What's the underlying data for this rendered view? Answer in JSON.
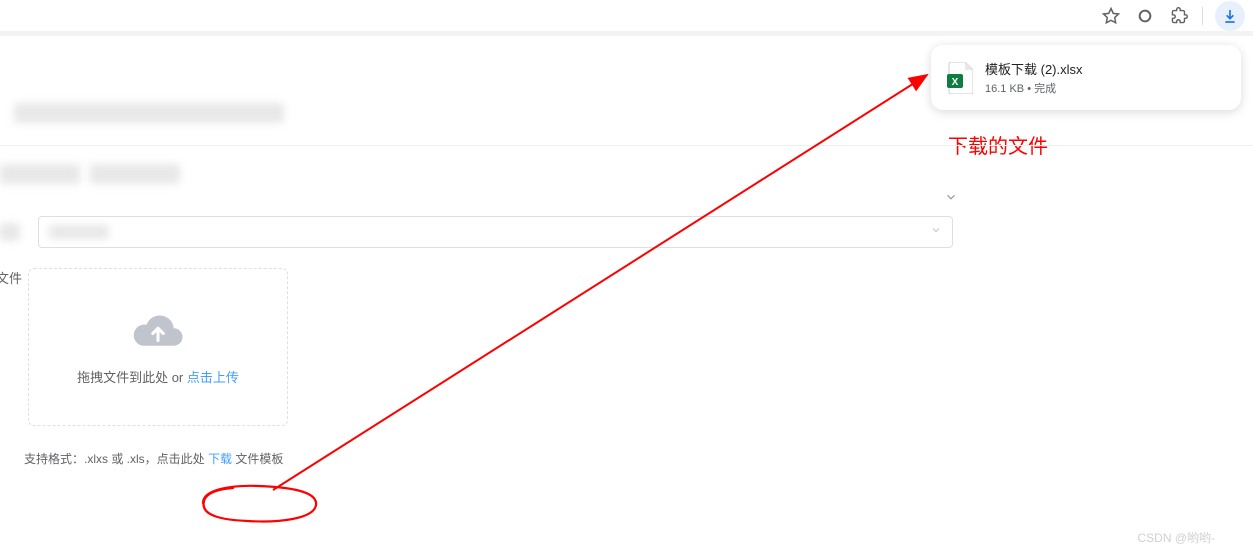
{
  "browser": {
    "icons": {
      "star": "☆",
      "circle": "◯",
      "puzzle": "🧩",
      "download": "↓"
    }
  },
  "download_popup": {
    "filename": "模板下载 (2).xlsx",
    "meta": "16.1 KB • 完成"
  },
  "annotation": {
    "text": "下载的文件",
    "arrow_color": "#ff0000"
  },
  "form": {
    "upload_label": "文件",
    "upload_text_drag": "拖拽文件到此处 or ",
    "upload_text_click": "点击上传",
    "hint_prefix": "支持格式：.xlxs 或 .xls，点击此处 ",
    "hint_link": "下载",
    "hint_suffix": " 文件模板"
  },
  "watermark": "CSDN @哟哟-"
}
